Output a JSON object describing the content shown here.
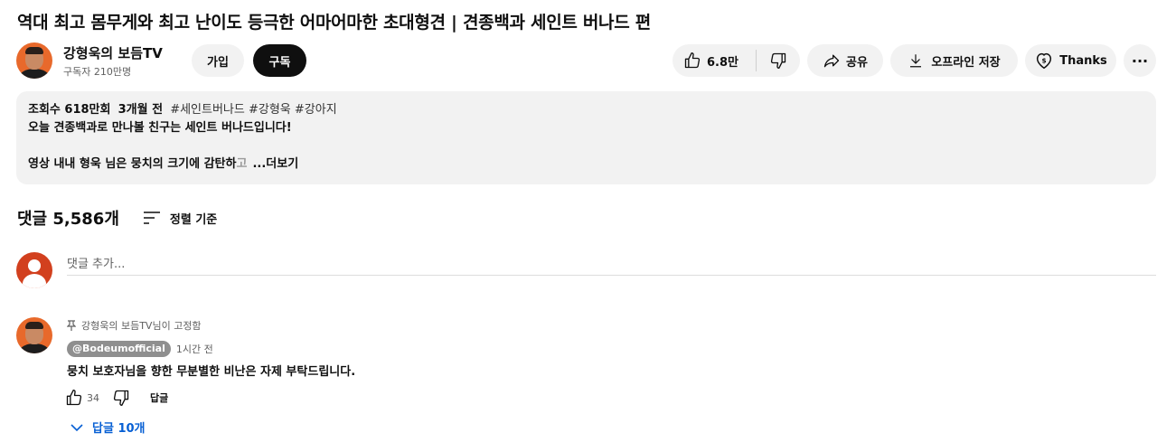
{
  "video": {
    "title": "역대 최고 몸무게와 최고 난이도 등극한 어마어마한 초대형견 | 견종백과 세인트 버나드 편"
  },
  "channel": {
    "name": "강형욱의 보듬TV",
    "subscribers": "구독자 210만명",
    "join_label": "가입",
    "subscribe_label": "구독"
  },
  "actions": {
    "like_count": "6.8만",
    "share_label": "공유",
    "download_label": "오프라인 저장",
    "thanks_label": "Thanks",
    "more_label": "···"
  },
  "description": {
    "views": "조회수 618만회",
    "age": "3개월 전",
    "tags": "#세인트버나드 #강형욱 #강아지",
    "line1": "오늘 견종백과로 만나볼 친구는 세인트 버나드입니다!",
    "line2_prefix": "영상 내내 형욱 님은 뭉치의 크기에 감탄하",
    "line2_fade": "고",
    "more_label": "...더보기"
  },
  "comments": {
    "count_label": "댓글 5,586개",
    "sort_label": "정렬 기준",
    "add_placeholder": "댓글 추가...",
    "items": [
      {
        "pinned_label": "강형욱의 보듬TV님이 고정함",
        "author": "@Bodeumofficial",
        "time": "1시간 전",
        "text": "뭉치 보호자님을 향한 무분별한 비난은 자제 부탁드립니다.",
        "like_count": "34",
        "reply_label": "답글",
        "replies_label": "답글 10개"
      }
    ]
  },
  "colors": {
    "avatar_orange": "#e8692b",
    "link_blue": "#065fd4",
    "pill_bg": "#f2f2f2"
  }
}
